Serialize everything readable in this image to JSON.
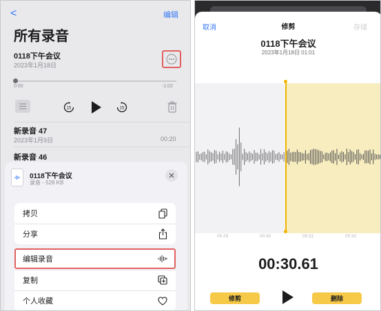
{
  "left": {
    "back_glyph": "<",
    "edit": "编辑",
    "title": "所有录音",
    "rec1": {
      "name": "0118下午会议",
      "date": "2023年1月18日",
      "start": "0:00",
      "end": "-1:02"
    },
    "rec2": {
      "name": "新录音 47",
      "date": "2023年1月9日",
      "duration": "00:20"
    },
    "rec3": {
      "name": "新录音 46",
      "date": "",
      "duration": ""
    },
    "sheet": {
      "file_name": "0118下午会议",
      "file_meta": "录音 - 528 KB",
      "menu": [
        {
          "label": "拷贝",
          "icon": "copy-icon"
        },
        {
          "label": "分享",
          "icon": "share-icon"
        },
        {
          "label": "编辑录音",
          "icon": "waveform-icon"
        },
        {
          "label": "复制",
          "icon": "duplicate-icon"
        },
        {
          "label": "个人收藏",
          "icon": "heart-icon"
        }
      ]
    }
  },
  "right": {
    "cancel": "取消",
    "header": "修剪",
    "save": "存储",
    "rec_name": "0118下午会议",
    "rec_sub": "2023年1月18日  01:01",
    "ticks": [
      "00:29",
      "00:30",
      "00:31",
      "00:32"
    ],
    "time": "00:30.61",
    "trim_button": "修剪",
    "delete_button": "删除"
  },
  "colors": {
    "accent": "#3478f6",
    "highlight": "#e0605f",
    "trim_yellow": "#f7c948"
  }
}
